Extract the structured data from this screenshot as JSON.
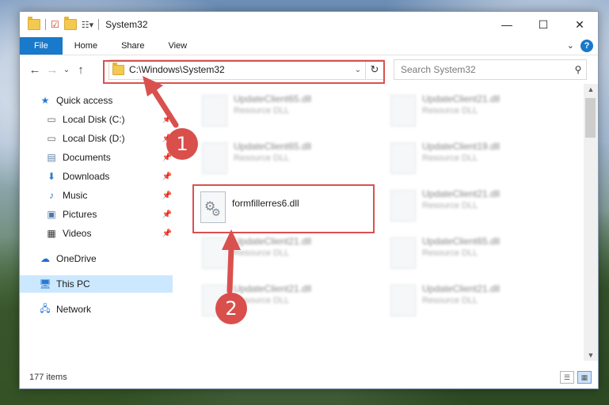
{
  "window": {
    "title": "System32",
    "controls": {
      "minimize": "—",
      "maximize": "☐",
      "close": "✕"
    }
  },
  "ribbon": {
    "tabs": [
      "File",
      "Home",
      "Share",
      "View"
    ],
    "help": "?",
    "collapse": "⌄"
  },
  "address": {
    "path": "C:\\Windows\\System32",
    "dropdown": "⌄",
    "refresh": "↻"
  },
  "search": {
    "placeholder": "Search System32"
  },
  "nav": {
    "back": "←",
    "forward": "→",
    "recent": "⌄",
    "up": "↑",
    "items": [
      {
        "label": "Quick access",
        "icon": "star-icon"
      },
      {
        "label": "Local Disk (C:)",
        "icon": "drive-icon"
      },
      {
        "label": "Local Disk (D:)",
        "icon": "drive-icon"
      },
      {
        "label": "Documents",
        "icon": "documents-icon"
      },
      {
        "label": "Downloads",
        "icon": "downloads-icon"
      },
      {
        "label": "Music",
        "icon": "music-icon"
      },
      {
        "label": "Pictures",
        "icon": "pictures-icon"
      },
      {
        "label": "Videos",
        "icon": "videos-icon"
      },
      {
        "label": "OneDrive",
        "icon": "cloud-icon"
      },
      {
        "label": "This PC",
        "icon": "computer-icon"
      },
      {
        "label": "Network",
        "icon": "network-icon"
      }
    ]
  },
  "files": [
    {
      "name": "UpdateClient65.dll",
      "type": "Resource DLL"
    },
    {
      "name": "UpdateClient21.dll",
      "type": "Resource DLL"
    },
    {
      "name": "UpdateClient65.dll",
      "type": "Resource DLL"
    },
    {
      "name": "UpdateClient19.dll",
      "type": "Resource DLL"
    },
    {
      "name": "formfillerres6.dll",
      "type": ""
    },
    {
      "name": "UpdateClient21.dll",
      "type": "Resource DLL"
    },
    {
      "name": "UpdateClient21.dll",
      "type": "Resource DLL"
    },
    {
      "name": "UpdateClient65.dll",
      "type": "Resource DLL"
    },
    {
      "name": "UpdateClient21.dll",
      "type": "Resource DLL"
    },
    {
      "name": "UpdateClient21.dll",
      "type": "Resource DLL"
    }
  ],
  "status": {
    "count": "177 items"
  },
  "annotations": {
    "step1": "1",
    "step2": "2",
    "color": "#d9514f"
  }
}
